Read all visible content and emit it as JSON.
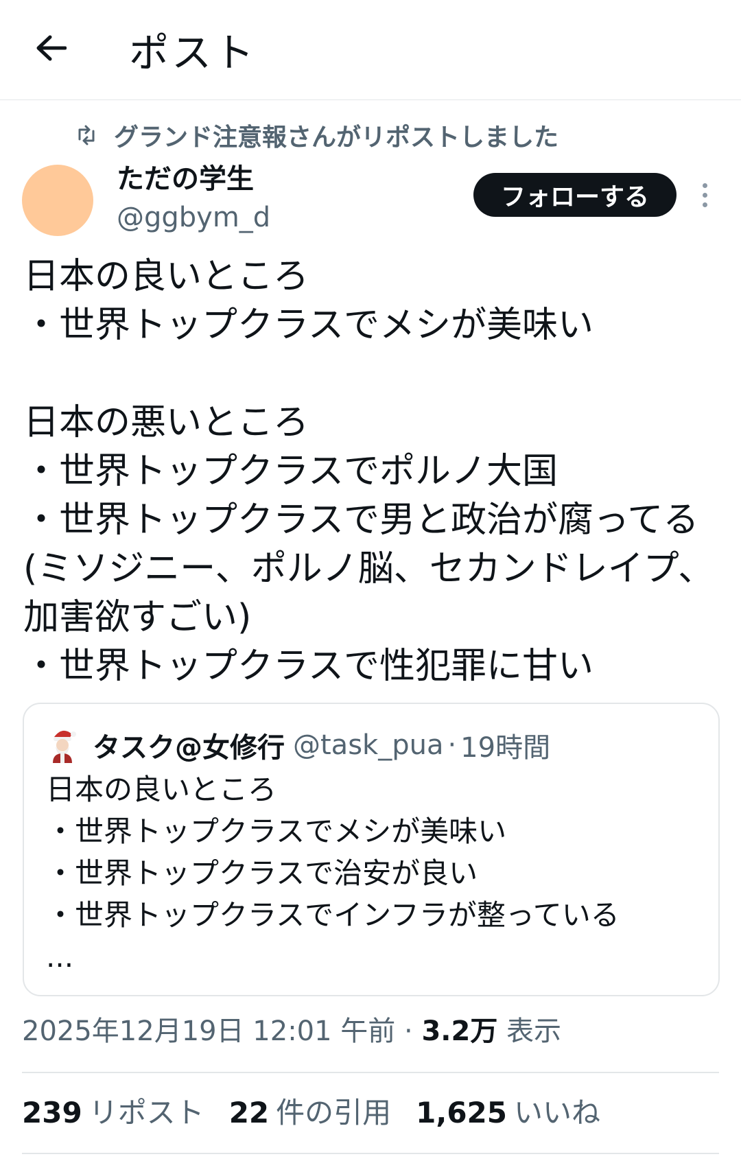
{
  "header": {
    "back_icon": "arrow-left-icon",
    "title": "ポスト"
  },
  "repost": {
    "icon": "repost-icon",
    "text": "グランド注意報さんがリポストしました"
  },
  "author": {
    "name": "ただの学生",
    "handle": "@ggbym_d",
    "avatar_color": "#ffc999",
    "follow_label": "フォローする",
    "more_icon": "more-vertical-icon"
  },
  "post": {
    "lines": [
      "日本の良いところ",
      "・世界トップクラスでメシが美味い",
      "",
      "日本の悪いところ",
      "・世界トップクラスでポルノ大国",
      "・世界トップクラスで男と政治が腐ってる",
      "(ミソジニー、ポルノ脳、セカンドレイプ、",
      "加害欲すごい)",
      "・世界トップクラスで性犯罪に甘い"
    ]
  },
  "quote": {
    "avatar_icon": "santa-character-avatar-icon",
    "name": "タスク@女修行",
    "handle": "@task_pua",
    "separator": "·",
    "time": "19時間",
    "lines": [
      "日本の良いところ",
      "・世界トップクラスでメシが美味い",
      "・世界トップクラスで治安が良い",
      "・世界トップクラスでインフラが整っている",
      "..."
    ]
  },
  "meta": {
    "timestamp": "2025年12月19日 12:01 午前",
    "separator": "·",
    "views_count": "3.2万",
    "views_label": "表示"
  },
  "stats": {
    "reposts_count": "239",
    "reposts_label": "リポスト",
    "quotes_count": "22",
    "quotes_label": "件の引用",
    "likes_count": "1,625",
    "likes_label": "いいね"
  },
  "colors": {
    "text_primary": "#0f1419",
    "text_secondary": "#536471",
    "border": "#e3e6e8",
    "follow_button_bg": "#0f1419"
  }
}
